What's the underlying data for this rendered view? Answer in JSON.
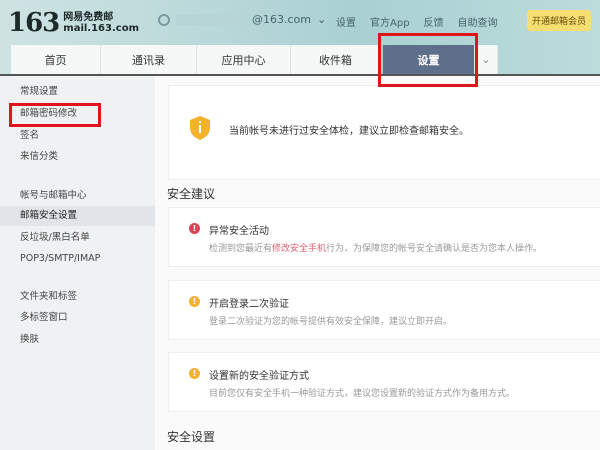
{
  "header": {
    "logo_number": "163",
    "logo_name": "网易免费邮",
    "logo_domain": "mail.163.com",
    "account": "@163.com",
    "links": [
      "设置",
      "官方App",
      "反馈",
      "自助查询"
    ],
    "vip_button": "开通邮箱会员"
  },
  "nav": {
    "tabs": [
      "首页",
      "通讯录",
      "应用中心",
      "收件箱",
      "设置"
    ]
  },
  "sidebar": {
    "items": [
      "常规设置",
      "邮箱密码修改",
      "签名",
      "来信分类",
      "帐号与邮箱中心",
      "邮箱安全设置",
      "反垃圾/黑白名单",
      "POP3/SMTP/IMAP",
      "文件夹和标签",
      "多标签窗口",
      "换肤"
    ]
  },
  "main": {
    "notice": "当前帐号未进行过安全体检，建议立即检查邮箱安全。",
    "section1": "安全建议",
    "cards": [
      {
        "title": "异常安全活动",
        "desc_pre": "检测到您最近有",
        "desc_link": "修改安全手机",
        "desc_post": "行为，为保障您的帐号安全请确认是否为您本人操作。",
        "color": "#e0405a"
      },
      {
        "title": "开启登录二次验证",
        "desc": "登录二次验证为您的帐号提供有效安全保障，建议立即开启。",
        "color": "#f2b32a"
      },
      {
        "title": "设置新的安全验证方式",
        "desc": "目前您仅有安全手机一种验证方式，建议您设置新的验证方式作为备用方式。",
        "color": "#f2b32a"
      }
    ],
    "section2": "安全设置"
  }
}
